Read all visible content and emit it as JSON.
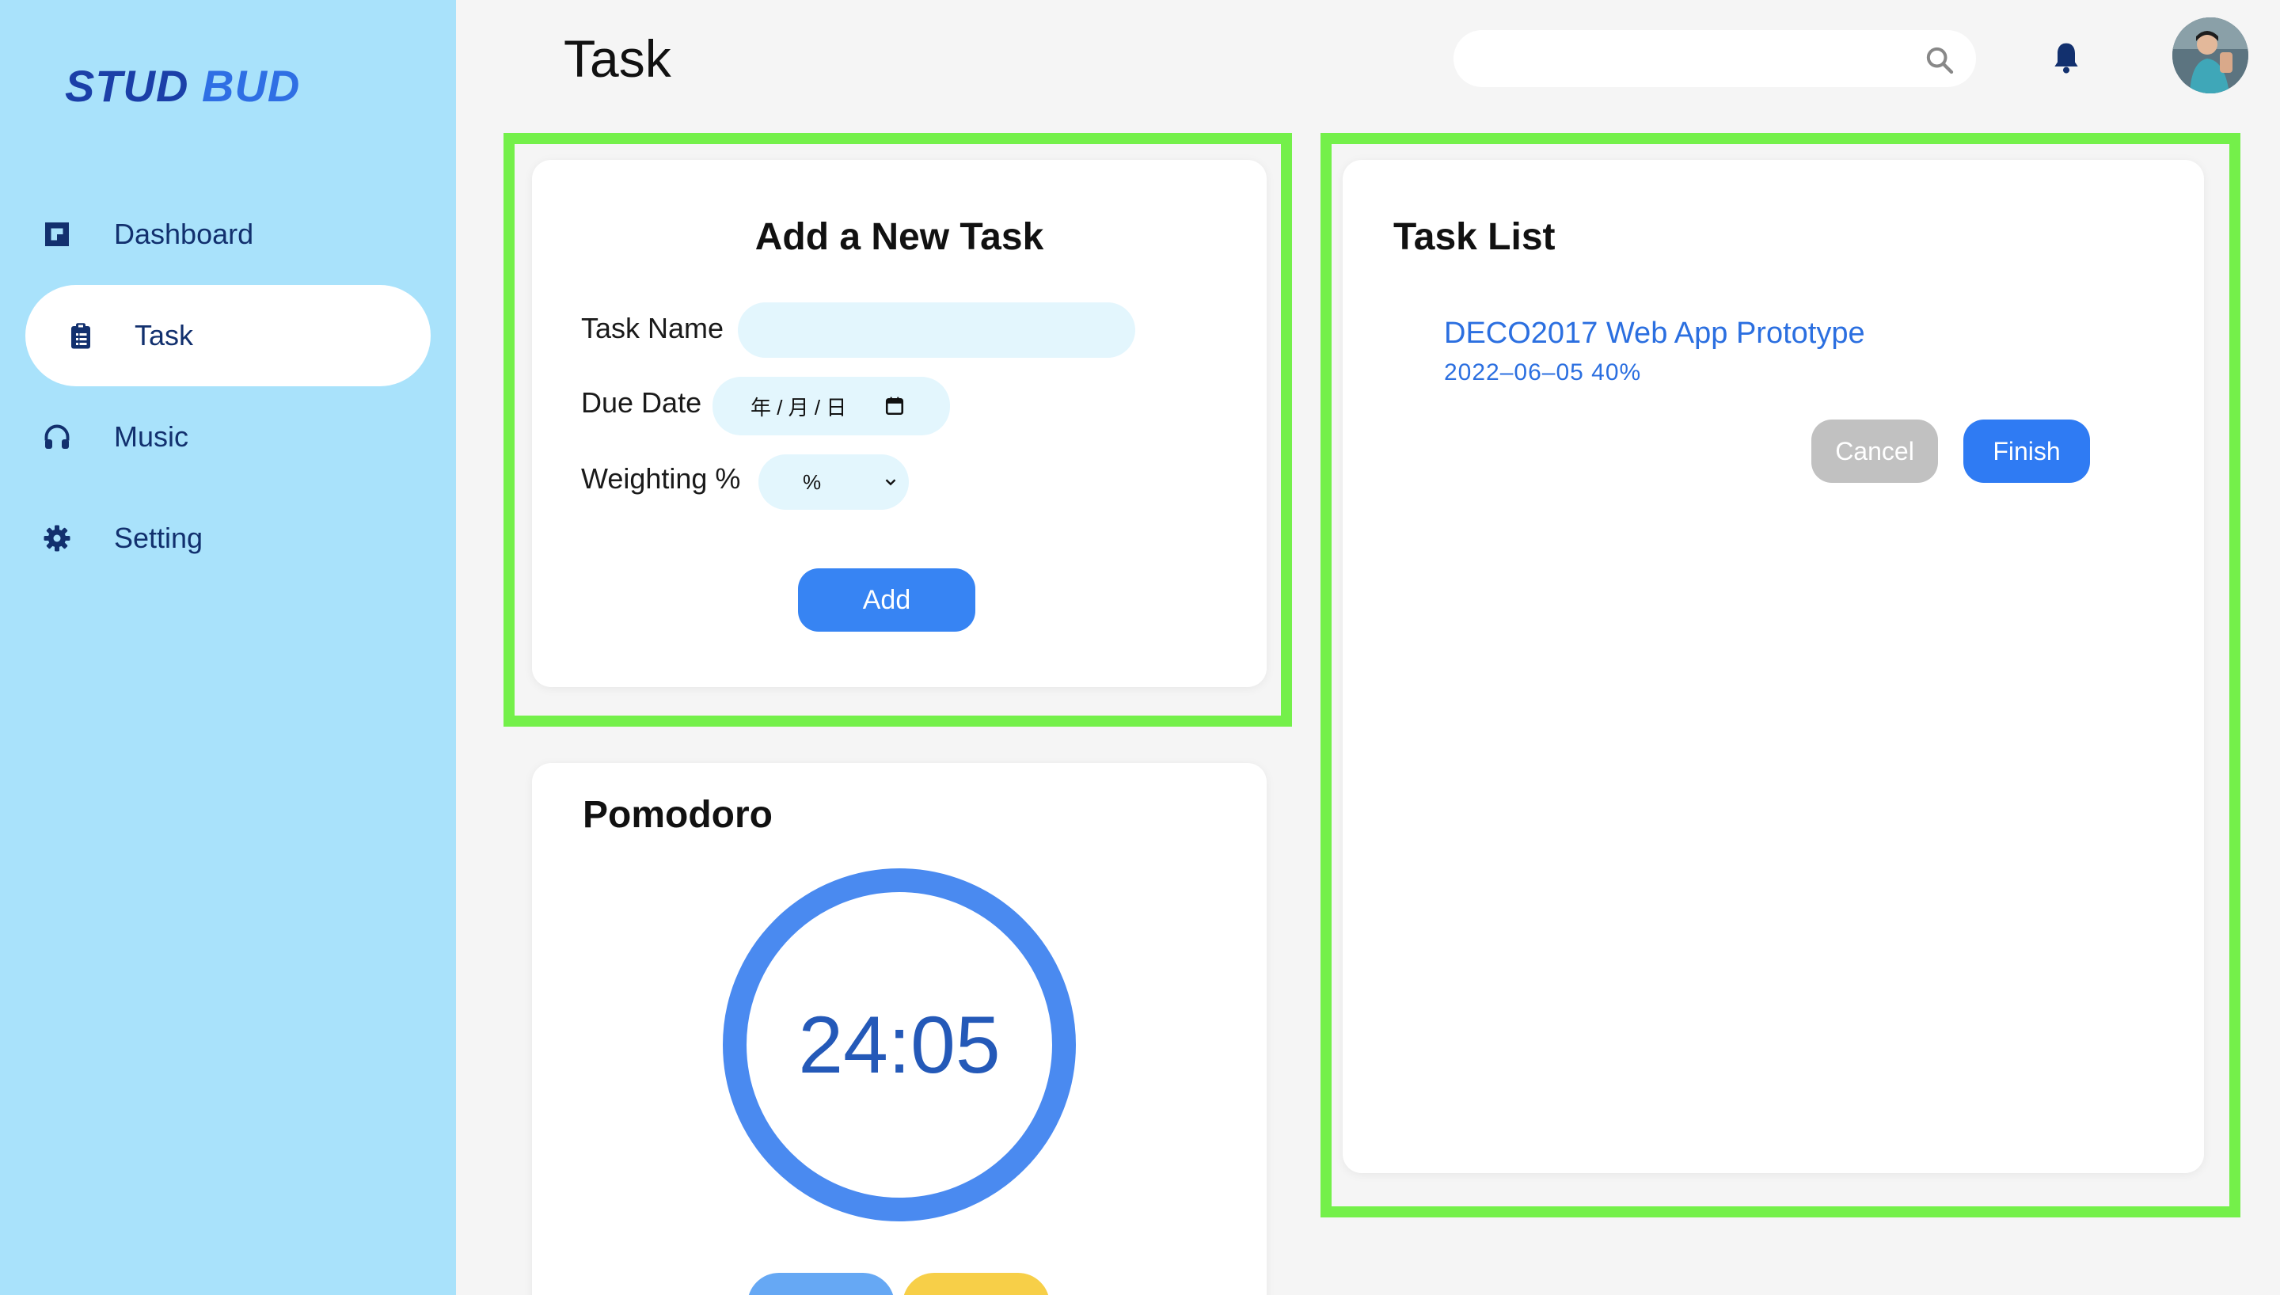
{
  "app": {
    "logo_word1": "STUD",
    "logo_word2": "BUD"
  },
  "sidebar": {
    "items": [
      {
        "label": "Dashboard",
        "icon": "dashboard-icon",
        "active": false
      },
      {
        "label": "Task",
        "icon": "clipboard-icon",
        "active": true
      },
      {
        "label": "Music",
        "icon": "headphones-icon",
        "active": false
      },
      {
        "label": "Setting",
        "icon": "gear-icon",
        "active": false
      }
    ]
  },
  "header": {
    "title": "Task",
    "search_placeholder": "",
    "search_icon": "search-icon",
    "bell_icon": "bell-icon"
  },
  "add_task": {
    "title": "Add a New Task",
    "task_name_label": "Task Name",
    "task_name_value": "",
    "due_date_label": "Due Date",
    "due_date_display": "年 / 月 / 日",
    "weighting_label": "Weighting %",
    "weighting_selected": "%",
    "add_button": "Add"
  },
  "task_list": {
    "title": "Task List",
    "tasks": [
      {
        "name": "DECO2017 Web App Prototype",
        "meta": "2022–06–05 40%"
      }
    ],
    "cancel_button": "Cancel",
    "finish_button": "Finish"
  },
  "pomodoro": {
    "title": "Pomodoro",
    "time": "24:05"
  },
  "colors": {
    "sidebar_bg": "#a9e2fb",
    "accent_blue": "#3784f3",
    "highlight_frame": "#74f04a",
    "cancel_gray": "#c1c1c1",
    "pomodoro_yellow": "#f7cf48"
  }
}
